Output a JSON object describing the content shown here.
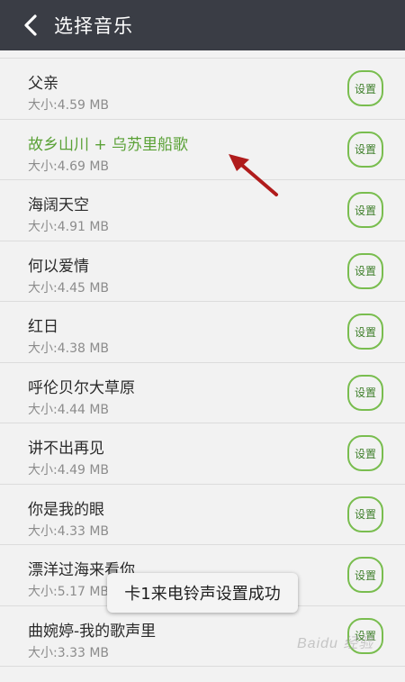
{
  "header": {
    "back_icon": "chevron-left-icon",
    "title": "选择音乐",
    "background": "#3a3d45"
  },
  "songs": [
    {
      "title": "父亲",
      "size": "大小:4.59 MB",
      "button": "设置",
      "active": false
    },
    {
      "title": "故乡山川 + 乌苏里船歌",
      "size": "大小:4.69 MB",
      "button": "设置",
      "active": true
    },
    {
      "title": "海阔天空",
      "size": "大小:4.91 MB",
      "button": "设置",
      "active": false
    },
    {
      "title": "何以爱情",
      "size": "大小:4.45 MB",
      "button": "设置",
      "active": false
    },
    {
      "title": "红日",
      "size": "大小:4.38 MB",
      "button": "设置",
      "active": false
    },
    {
      "title": "呼伦贝尔大草原",
      "size": "大小:4.44 MB",
      "button": "设置",
      "active": false
    },
    {
      "title": "讲不出再见",
      "size": "大小:4.49 MB",
      "button": "设置",
      "active": false
    },
    {
      "title": "你是我的眼",
      "size": "大小:4.33 MB",
      "button": "设置",
      "active": false
    },
    {
      "title": "漂洋过海来看你",
      "size": "大小:5.17 MB",
      "button": "设置",
      "active": false
    },
    {
      "title": "曲婉婷-我的歌声里",
      "size": "大小:3.33 MB",
      "button": "设置",
      "active": false
    }
  ],
  "toast": {
    "message": "卡1来电铃声设置成功"
  },
  "annotation": {
    "arrow_icon": "red-arrow-icon",
    "color": "#b01c1c"
  },
  "watermark": {
    "text": "Baidu 经验"
  },
  "colors": {
    "accent_green": "#5aa136",
    "button_border": "#79bd4f"
  }
}
